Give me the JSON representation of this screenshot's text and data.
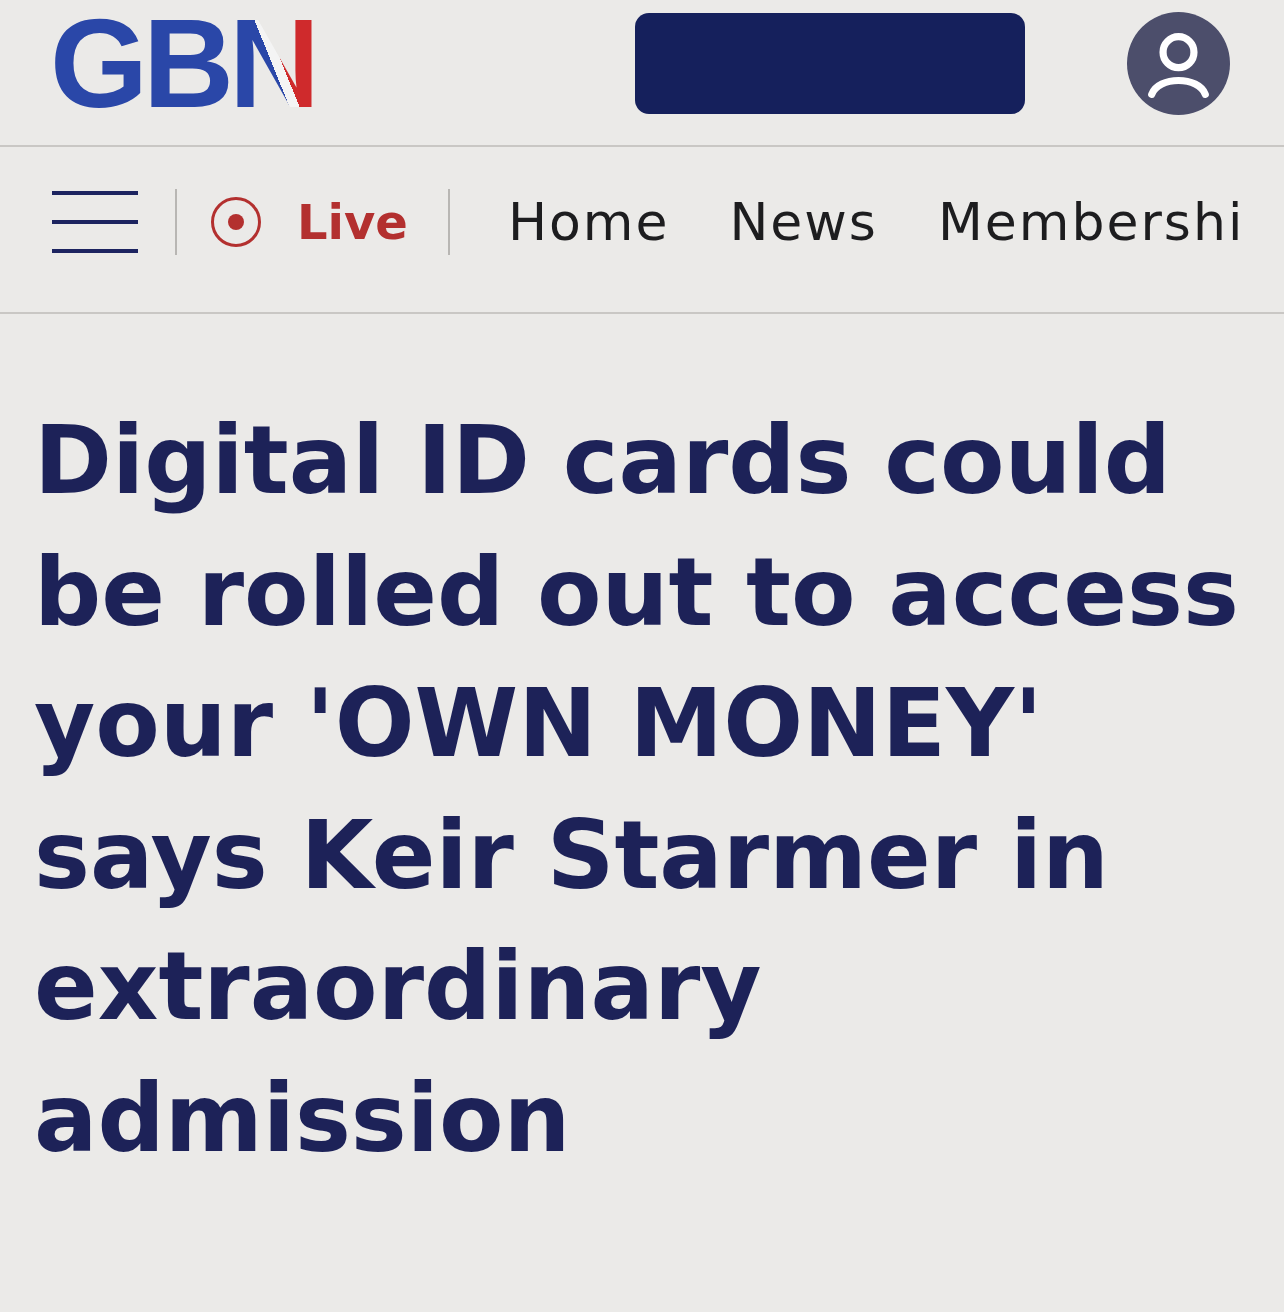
{
  "header": {
    "logo": "GBN"
  },
  "nav": {
    "live": {
      "label": "Live"
    },
    "links": [
      {
        "label": "Home"
      },
      {
        "label": "News"
      },
      {
        "label": "Membershi"
      }
    ]
  },
  "article": {
    "headline": "Digital ID cards could be rolled out to access your 'OWN MONEY' says Keir Starmer in extraordinary admission"
  }
}
